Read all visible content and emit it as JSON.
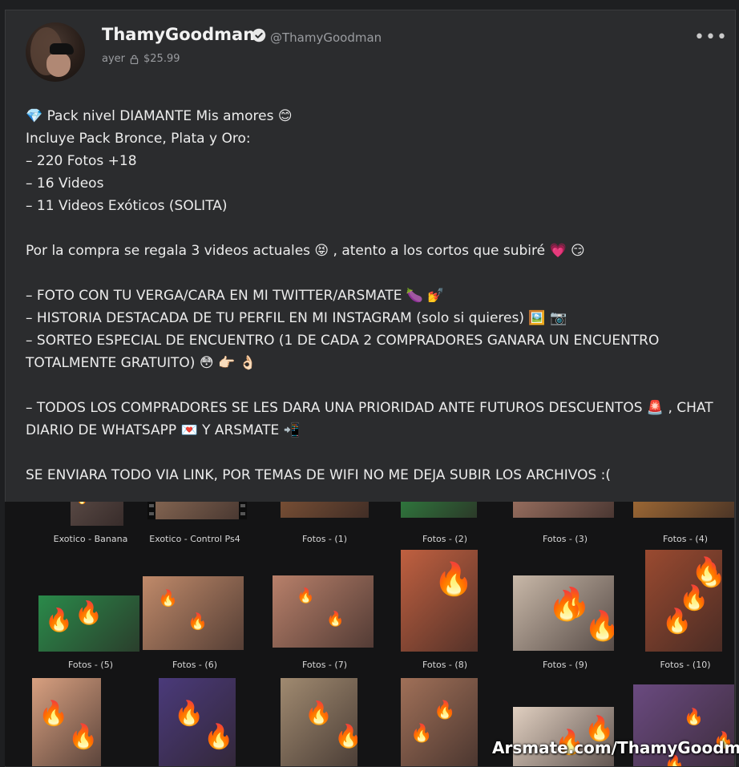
{
  "post": {
    "author_name": "ThamyGoodman",
    "author_handle": "@ThamyGoodman",
    "time": "ayer",
    "price": "$25.99",
    "more_label": "•••",
    "lines": [
      "💎 Pack nivel DIAMANTE Mis amores 😊",
      "Incluye Pack Bronce, Plata y Oro:",
      "– 220 Fotos +18",
      "– 16 Videos",
      "– 11 Videos Exóticos (SOLITA)",
      "",
      "Por la compra se regala 3 videos actuales 😝 , atento a los cortos que subiré 💗 😏",
      "",
      "– FOTO CON TU VERGA/CARA EN MI TWITTER/ARSMATE 🍆 💅",
      "– HISTORIA DESTACADA DE TU PERFIL EN MI INSTAGRAM (solo si quieres) 🖼️ 📷",
      "– SORTEO ESPECIAL DE ENCUENTRO (1 DE CADA 2 COMPRADORES GANARA UN ENCUENTRO",
      "TOTALMENTE GRATUITO) 😳 👉🏻 👌🏻",
      "",
      "– TODOS LOS COMPRADORES SE LES DARA UNA PRIORIDAD ANTE FUTUROS DESCUENTOS 🚨 , CHAT",
      "DIARIO DE WHATSAPP 💌 Y ARSMATE 📲",
      "",
      "SE ENVIARA TODO VIA LINK, POR TEMAS DE WIFI NO ME DEJA SUBIR LOS ARCHIVOS :("
    ]
  },
  "gallery": {
    "fire_glyph": "🔥",
    "watermark": "Arsmate.com/ThamyGoodman",
    "items": [
      {
        "caption": "Exotico - Banana",
        "color": "#5a4a45"
      },
      {
        "caption": "Exotico - Control Ps4",
        "color": "#8a6a55"
      },
      {
        "caption": "Fotos - (1)",
        "color": "#7a5035"
      },
      {
        "caption": "Fotos - (2)",
        "color": "#2f7a3e"
      },
      {
        "caption": "Fotos - (3)",
        "color": "#9a7060"
      },
      {
        "caption": "Fotos - (4)",
        "color": "#a06a35"
      },
      {
        "caption": "Fotos - (5)",
        "color": "#2a8a4a"
      },
      {
        "caption": "Fotos - (6)",
        "color": "#c08a6a"
      },
      {
        "caption": "Fotos - (7)",
        "color": "#b8806a"
      },
      {
        "caption": "Fotos - (8)",
        "color": "#c06040"
      },
      {
        "caption": "Fotos - (9)",
        "color": "#c8b8a8"
      },
      {
        "caption": "Fotos - (10)",
        "color": "#9a4a30"
      },
      {
        "caption": "",
        "color": "#d8a080"
      },
      {
        "caption": "",
        "color": "#4a3a7a"
      },
      {
        "caption": "",
        "color": "#a08a70"
      },
      {
        "caption": "",
        "color": "#a07058"
      },
      {
        "caption": "",
        "color": "#e0cfc0"
      },
      {
        "caption": "",
        "color": "#6a4a80"
      }
    ]
  }
}
